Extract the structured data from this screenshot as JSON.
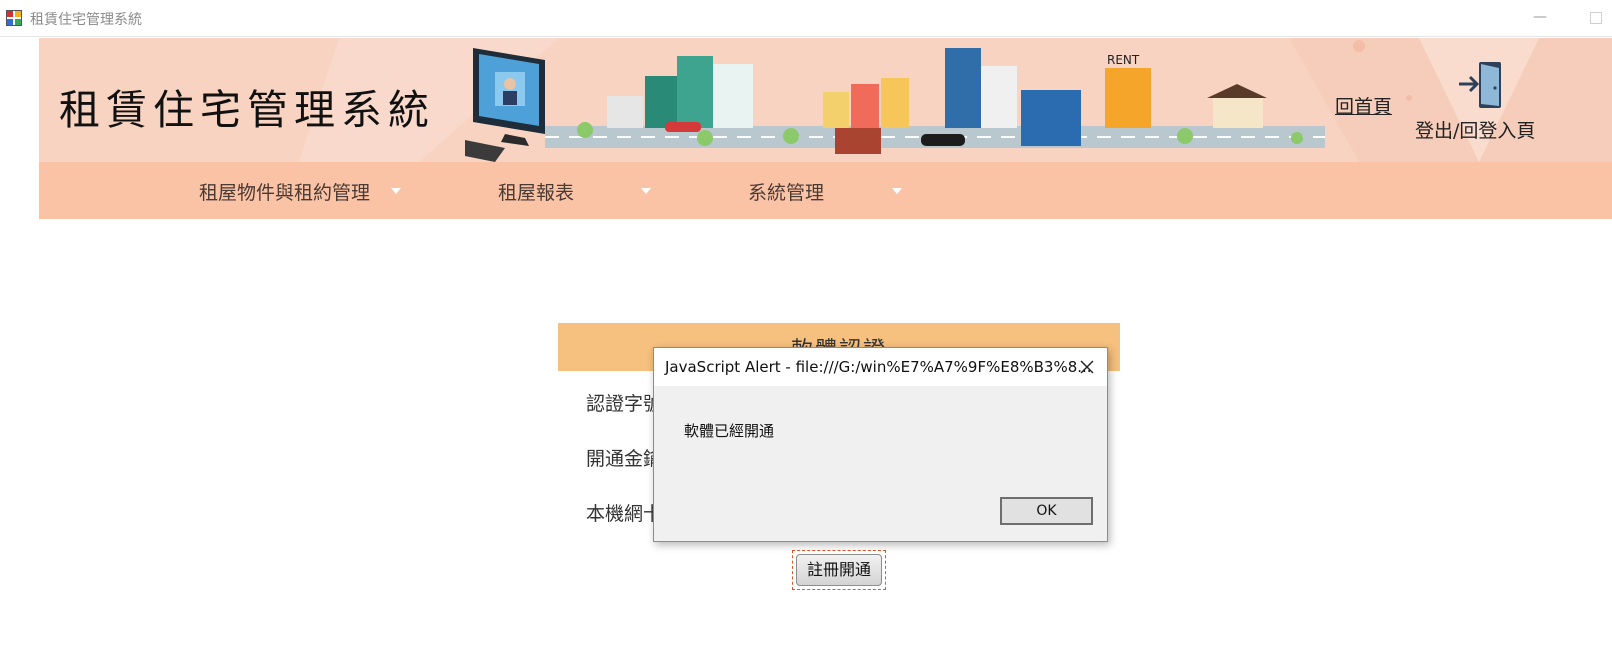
{
  "window": {
    "title": "租賃住宅管理系統",
    "minimize_glyph": "—"
  },
  "banner": {
    "site_title": "租賃住宅管理系統",
    "rent_sign": "RENT",
    "home_link": "回首頁",
    "logout_label": "登出/回登入頁"
  },
  "nav": {
    "items": [
      {
        "label": "租屋物件與租約管理"
      },
      {
        "label": "租屋報表"
      },
      {
        "label": "系統管理"
      }
    ]
  },
  "form": {
    "header": "軟體認證",
    "labels": [
      "認證字號",
      "開通金鑰",
      "本機網卡"
    ],
    "register_button": "註冊開通"
  },
  "dialog": {
    "title": "JavaScript Alert - file:///G:/win%E7%A7%9F%E8%B3%8...",
    "message": "軟體已經開通",
    "ok_label": "OK"
  },
  "colors": {
    "banner_bg": "#f8d3c2",
    "navbar_bg": "#fbc3a6",
    "form_header_bg": "#f6c07e",
    "dialog_bg": "#f0f0f0",
    "register_focus": "#e0572b"
  }
}
